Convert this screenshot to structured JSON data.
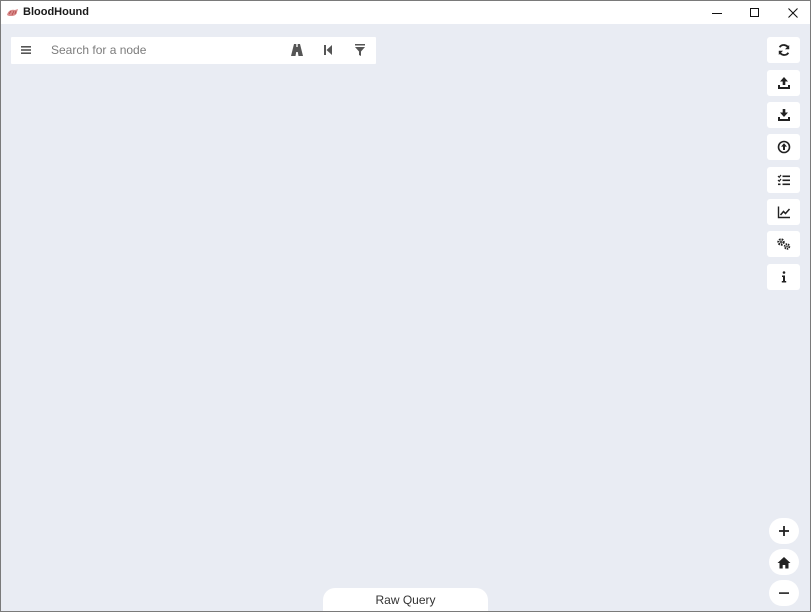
{
  "window": {
    "title": "BloodHound",
    "controls": [
      "minimize",
      "maximize",
      "close"
    ]
  },
  "search": {
    "placeholder": "Search for a node",
    "value": ""
  },
  "search_bar_icons": [
    "menu-icon",
    "path-finding-icon",
    "back-icon",
    "filter-icon"
  ],
  "toolbar": {
    "buttons": [
      {
        "icon": "refresh-icon"
      },
      {
        "icon": "upload-icon"
      },
      {
        "icon": "download-icon"
      },
      {
        "icon": "upload-data-icon"
      },
      {
        "icon": "queries-list-icon"
      },
      {
        "icon": "chart-icon"
      },
      {
        "icon": "settings-icon"
      },
      {
        "icon": "info-icon"
      }
    ]
  },
  "zoom": {
    "buttons": [
      {
        "icon": "zoom-in-icon"
      },
      {
        "icon": "home-icon"
      },
      {
        "icon": "zoom-out-icon"
      }
    ]
  },
  "raw_query": {
    "label": "Raw Query"
  },
  "colors": {
    "canvas_bg": "#e9ecf3",
    "panel_bg": "#ffffff",
    "icon": "#333333",
    "logo": "#c0392b"
  }
}
